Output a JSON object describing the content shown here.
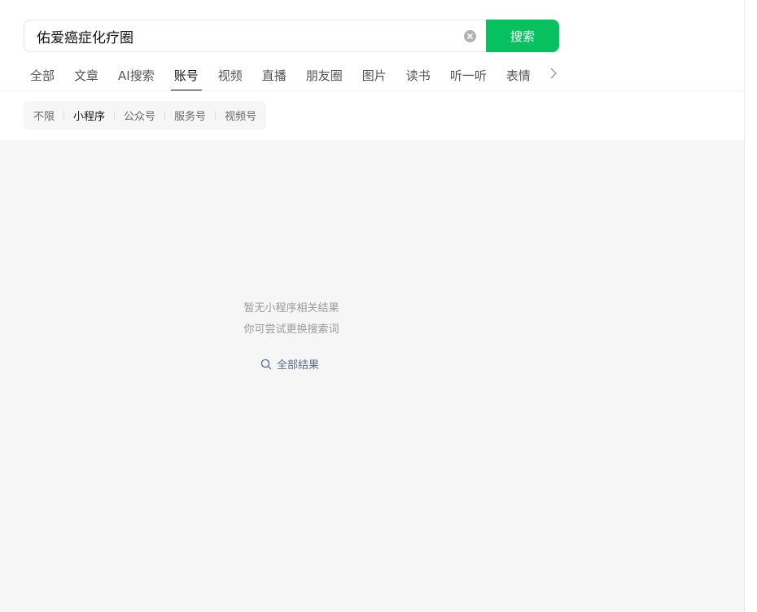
{
  "search": {
    "query": "佑爱癌症化疗圈",
    "button_label": "搜索"
  },
  "tabs": [
    {
      "label": "全部",
      "active": false
    },
    {
      "label": "文章",
      "active": false
    },
    {
      "label": "AI搜索",
      "active": false
    },
    {
      "label": "账号",
      "active": true
    },
    {
      "label": "视频",
      "active": false
    },
    {
      "label": "直播",
      "active": false
    },
    {
      "label": "朋友圈",
      "active": false
    },
    {
      "label": "图片",
      "active": false
    },
    {
      "label": "读书",
      "active": false
    },
    {
      "label": "听一听",
      "active": false
    },
    {
      "label": "表情",
      "active": false
    }
  ],
  "filters": [
    {
      "label": "不限",
      "active": false
    },
    {
      "label": "小程序",
      "active": true
    },
    {
      "label": "公众号",
      "active": false
    },
    {
      "label": "服务号",
      "active": false
    },
    {
      "label": "视频号",
      "active": false
    }
  ],
  "empty_state": {
    "line1": "暂无小程序相关结果",
    "line2": "你可尝试更换搜索词",
    "link_label": "全部结果"
  },
  "colors": {
    "accent": "#07c160",
    "link": "#576b95",
    "background": "#f6f6f6"
  },
  "icons": {
    "clear": "clear-icon",
    "next": "chevron-right-icon",
    "search": "search-icon"
  }
}
